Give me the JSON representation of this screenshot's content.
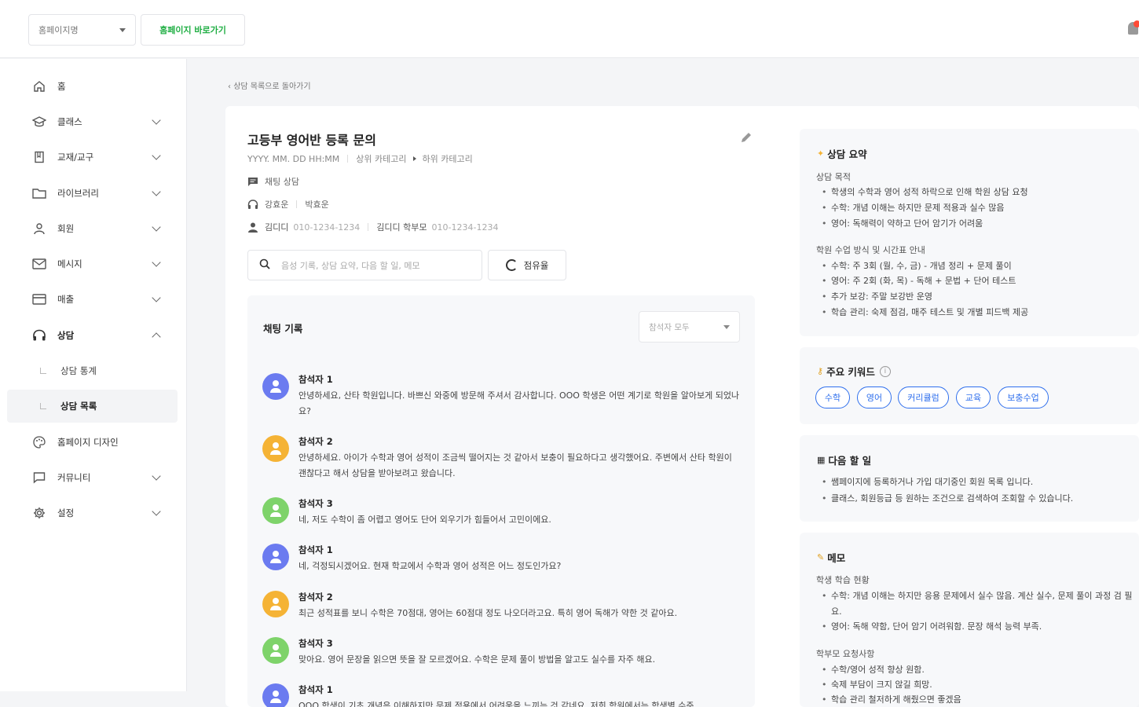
{
  "header": {
    "site_select": "홈페이지명",
    "site_go": "홈페이지 바로가기"
  },
  "sidebar": {
    "items": [
      {
        "label": "홈",
        "icon": "home-icon"
      },
      {
        "label": "클래스",
        "icon": "graduation-cap-icon"
      },
      {
        "label": "교재/교구",
        "icon": "book-icon"
      },
      {
        "label": "라이브러리",
        "icon": "folder-icon"
      },
      {
        "label": "회원",
        "icon": "user-icon"
      },
      {
        "label": "메시지",
        "icon": "mail-icon"
      },
      {
        "label": "매출",
        "icon": "card-icon"
      },
      {
        "label": "상담",
        "icon": "headset-icon"
      },
      {
        "label": "상담 통계"
      },
      {
        "label": "상담 목록"
      },
      {
        "label": "홈페이지 디자인",
        "icon": "palette-icon"
      },
      {
        "label": "커뮤니티",
        "icon": "chat-bubble-icon"
      },
      {
        "label": "설정",
        "icon": "gear-icon"
      }
    ]
  },
  "back_link": "상담 목록으로 돌아가기",
  "consult": {
    "title": "고등부 영어반 등록 문의",
    "datetime": "YYYY. MM. DD HH:MM",
    "category_parent": "상위 카테고리",
    "category_child": "하위 카테고리",
    "type": "채팅 상담",
    "counselor1": "강효운",
    "counselor2": "박효운",
    "student_name": "김디디",
    "student_phone": "010-1234-1234",
    "parent_name": "김디디 학부모",
    "parent_phone": "010-1234-1234",
    "search_placeholder": "음성 기록, 상담 요약, 다음 할 일, 메모",
    "sort_label": "점유율"
  },
  "chat": {
    "title": "채팅 기록",
    "filter": "참석자 모두",
    "messages": [
      {
        "name": "참석자 1",
        "color": "#6b7bf0",
        "text": "안녕하세요, 산타 학원입니다. 바쁘신 와중에 방문해 주셔서 감사합니다. OOO 학생은 어떤 계기로 학원을 알아보게 되었나요?"
      },
      {
        "name": "참석자 2",
        "color": "#f5b335",
        "text": "안녕하세요. 아이가 수학과 영어 성적이 조금씩 떨어지는 것 같아서 보충이 필요하다고 생각했어요. 주변에서 산타 학원이 괜찮다고 해서 상담을 받아보려고 왔습니다."
      },
      {
        "name": "참석자 3",
        "color": "#7ed36a",
        "text": "네, 저도 수학이 좀 어렵고 영어도 단어 외우기가 힘들어서 고민이에요."
      },
      {
        "name": "참석자 1",
        "color": "#6b7bf0",
        "text": "네, 걱정되시겠어요. 현재 학교에서 수학과 영어 성적은 어느 정도인가요?"
      },
      {
        "name": "참석자 2",
        "color": "#f5b335",
        "text": "최근 성적표를 보니 수학은 70점대, 영어는 60점대 정도 나오더라고요. 특히 영어 독해가 약한 것 같아요."
      },
      {
        "name": "참석자 3",
        "color": "#7ed36a",
        "text": "맞아요. 영어 문장을 읽으면 뜻을 잘 모르겠어요. 수학은 문제 풀이 방법을 알고도 실수를 자주 해요."
      },
      {
        "name": "참석자 1",
        "color": "#6b7bf0",
        "text": "OOO 학생이 기초 개념은 이해하지만 문제 적용에서 어려움을 느끼는 것 같네요. 저희 학원에서는 학생별 수준"
      }
    ]
  },
  "summary": {
    "title": "상담 요약",
    "purpose_title": "상담 목적",
    "purpose": [
      "학생의 수학과 영어 성적 하락으로 인해 학원 상담 요청",
      "수학: 개념 이해는 하지만 문제 적용과 실수 많음",
      "영어: 독해력이 약하고 단어 암기가 어려움"
    ],
    "method_title": "학원 수업 방식 및 시간표 안내",
    "method": [
      "수학: 주 3회 (월, 수, 금) - 개념 정리 + 문제 풀이",
      "영어: 주 2회 (화, 목) - 독해 + 문법 + 단어 테스트",
      "추가 보강: 주말 보강반 운영",
      "학습 관리: 숙제 점검, 매주 테스트 및 개별 피드백 제공"
    ]
  },
  "keywords": {
    "title": "주요 키워드",
    "items": [
      "수학",
      "영어",
      "커리큘럼",
      "교육",
      "보충수업"
    ]
  },
  "todo": {
    "title": "다음 할 일",
    "items": [
      "쌤페이지에 등록하거나 가입 대기중인 회원 목록 입니다.",
      "클래스, 회원등급 등 원하는 조건으로 검색하여 조회할 수 있습니다."
    ]
  },
  "memo": {
    "title": "메모",
    "status_title": "학생 학습 현황",
    "status": [
      "수학: 개념 이해는 하지만 응용 문제에서 실수 많음. 계산 실수, 문제 풀이 과정 검 필요.",
      "영어: 독해 약함, 단어 암기 어려워함. 문장 해석 능력 부족."
    ],
    "parent_title": "학부모 요청사항",
    "parent": [
      "수학/영어 성적 향상 원함.",
      "숙제 부담이 크지 않길 희망.",
      "학습 관리 철저하게 해줬으면 좋겠음"
    ]
  }
}
